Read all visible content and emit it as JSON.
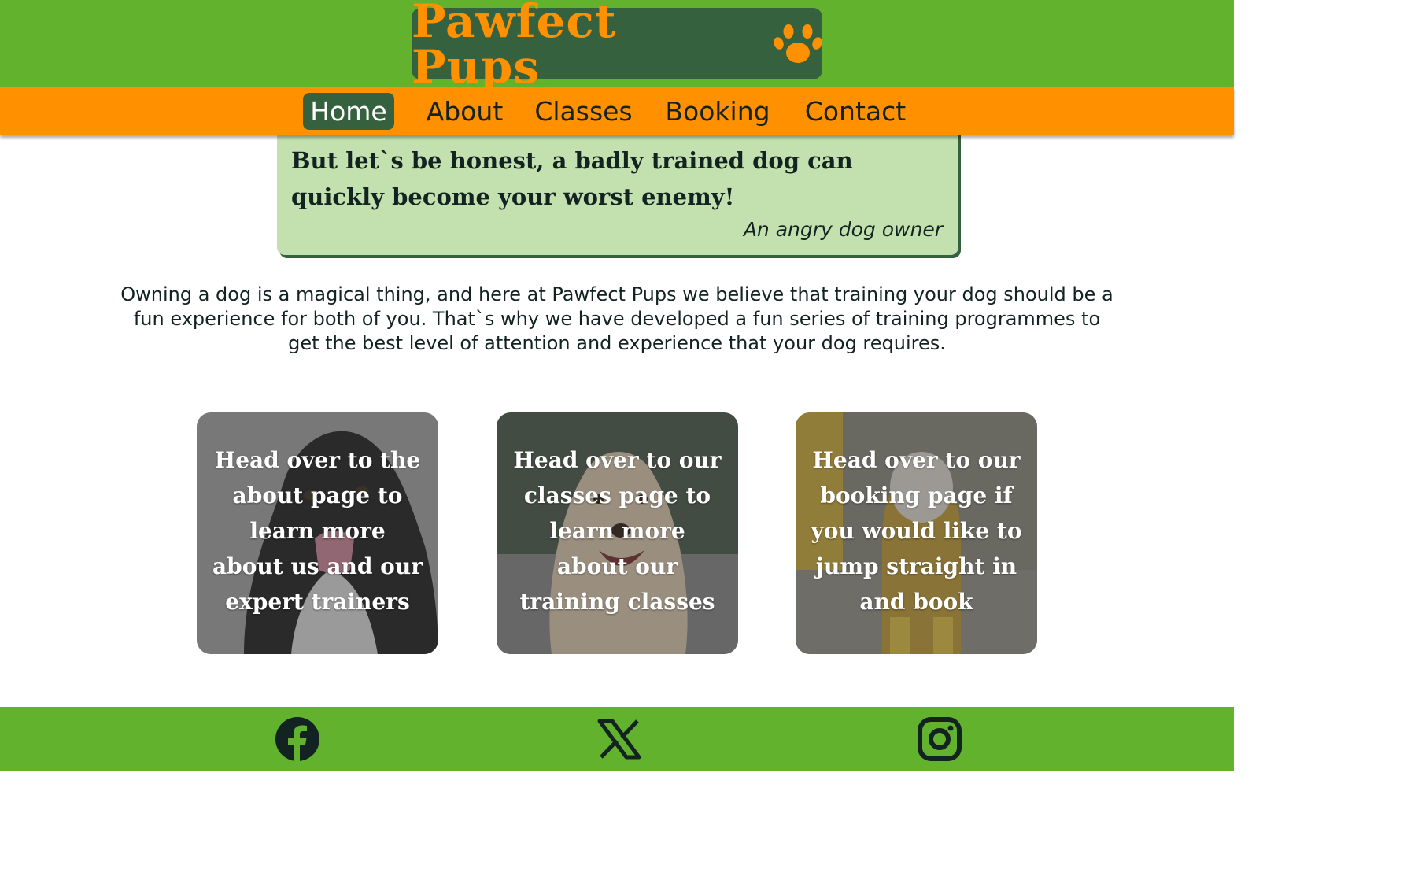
{
  "header": {
    "logo_text": "Pawfect Pups",
    "logo_icon": "paw-icon"
  },
  "nav": {
    "items": [
      {
        "label": "Home",
        "active": true
      },
      {
        "label": "About",
        "active": false
      },
      {
        "label": "Classes",
        "active": false
      },
      {
        "label": "Booking",
        "active": false
      },
      {
        "label": "Contact",
        "active": false
      }
    ]
  },
  "quote": {
    "text": "But let`s be honest, a badly trained dog can quickly become your worst enemy!",
    "author": "An angry dog owner"
  },
  "intro": {
    "text": "Owning a dog is a magical thing, and here at Pawfect Pups we believe that training your dog should be a fun experience for both of you. That`s why we have developed a fun series of training programmes to get the best level of attention and experience that your dog requires."
  },
  "cards": [
    {
      "text": "Head over to the about page to learn more about us and our expert trainers",
      "image": "black-and-white-dog-photo"
    },
    {
      "text": "Head over to our classes page to learn more about our training classes",
      "image": "golden-retriever-photo"
    },
    {
      "text": "Head over to our booking page if you would like to jump straight in and book",
      "image": "dog-in-yellow-raincoat-photo"
    }
  ],
  "footer": {
    "icons": [
      "facebook-icon",
      "x-icon",
      "instagram-icon"
    ]
  },
  "colors": {
    "primary_green": "#63b22e",
    "dark_green": "#35613f",
    "orange": "#ff9100",
    "light_green": "#c3e1af",
    "text_dark": "#132322"
  }
}
